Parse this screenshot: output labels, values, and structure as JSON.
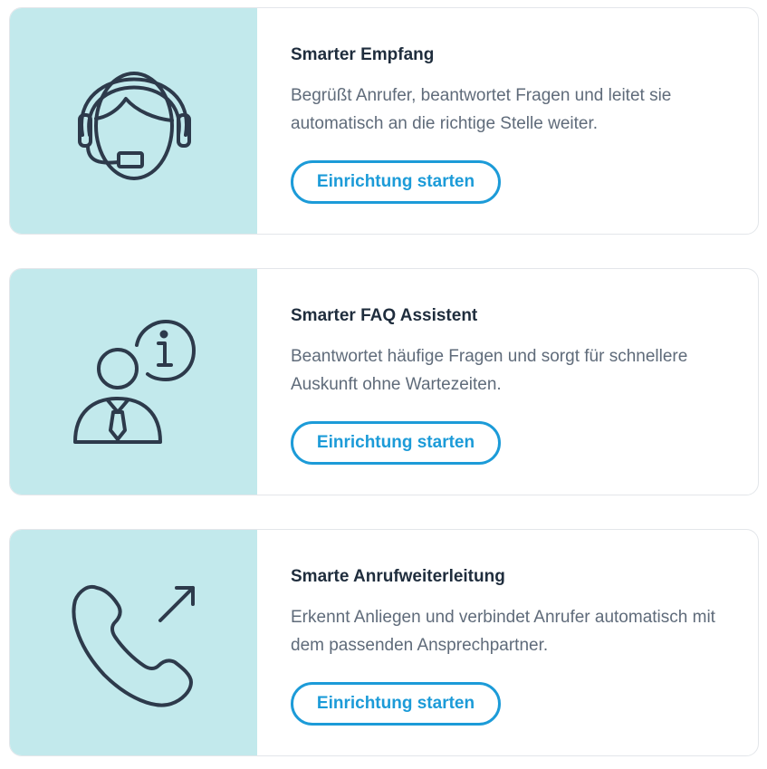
{
  "cards": [
    {
      "title": "Smarter Empfang",
      "description": "Begrüßt Anrufer, beantwortet Fragen und leitet sie automatisch an die richtige Stelle weiter.",
      "button_label": "Einrichtung starten",
      "icon": "headset-agent-icon"
    },
    {
      "title": "Smarter FAQ Assistent",
      "description": "Beantwortet häufige Fragen und sorgt für schnellere Auskunft ohne Wartezeiten.",
      "button_label": "Einrichtung starten",
      "icon": "person-info-icon"
    },
    {
      "title": "Smarte Anrufweiterleitung",
      "description": "Erkennt Anliegen und verbindet Anrufer automatisch mit dem passenden Ansprechpartner.",
      "button_label": "Einrichtung starten",
      "icon": "phone-forward-icon"
    }
  ],
  "colors": {
    "icon_panel_bg": "#c2e9ec",
    "icon_stroke": "#2d3a4b",
    "accent": "#1c9bd8",
    "title": "#1f2d3d",
    "text": "#5f6b7a",
    "card_border": "#e3e6ea"
  }
}
